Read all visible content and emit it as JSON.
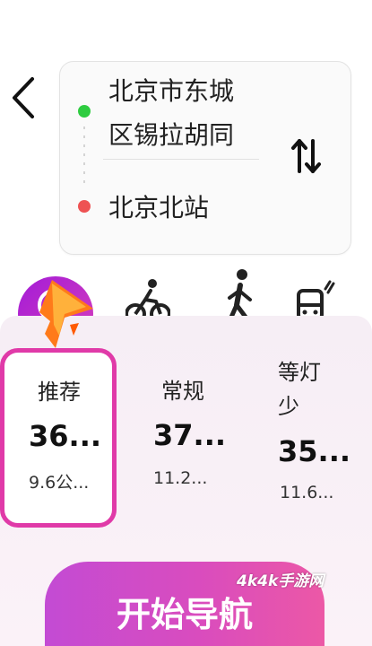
{
  "route": {
    "origin": "北京市东城区锡拉胡同",
    "destination": "北京北站"
  },
  "modes": [
    {
      "name": "drive",
      "icon": "car-icon"
    },
    {
      "name": "cycling",
      "icon": "bike-icon"
    },
    {
      "name": "walk",
      "icon": "walk-icon"
    },
    {
      "name": "transit",
      "icon": "bus-icon"
    }
  ],
  "options": [
    {
      "name": "推荐",
      "time": "36...",
      "distance": "9.6公..."
    },
    {
      "name": "常规",
      "time": "37...",
      "distance": "11.2..."
    },
    {
      "name": "等灯少",
      "time": "35...",
      "distance": "11.6..."
    }
  ],
  "start_button": "开始导航",
  "watermark": "4k4k手游网",
  "colors": {
    "accent": "#e03aa8",
    "start_dot": "#2ecc40",
    "end_dot": "#ee5253",
    "button_gradient_start": "#c34bd4",
    "button_gradient_end": "#ec58a6"
  }
}
